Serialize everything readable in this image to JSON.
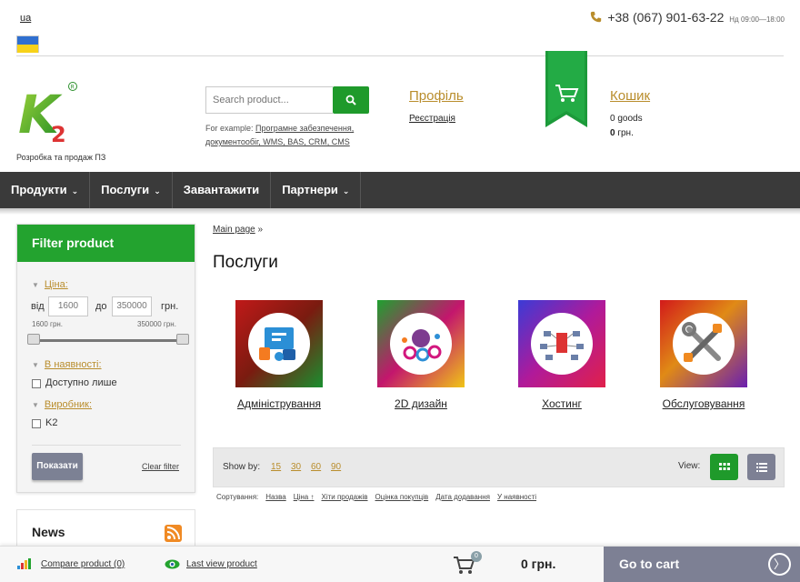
{
  "header": {
    "lang": "ua",
    "phone": "+38 (067) 901-63-22",
    "hours": "Нд 09:00—18:00",
    "logo_letter": "K",
    "logo_sup": "2",
    "logo_tagline": "Розробка та продаж ПЗ",
    "search_placeholder": "Search product...",
    "example_prefix": "For example:",
    "example_links": "Програмне забезпечення, документообіг, WMS, BAS, CRM, CMS",
    "profile_label": "Профіль",
    "register_label": "Реєстрація",
    "cart_label": "Кошик",
    "cart_goods": "0 goods",
    "cart_price_num": "0",
    "cart_price_cur": "грн."
  },
  "nav": {
    "items": [
      {
        "label": "Продукти"
      },
      {
        "label": "Послуги"
      },
      {
        "label": "Завантажити"
      },
      {
        "label": "Партнери"
      }
    ]
  },
  "filter": {
    "title": "Filter product",
    "price_section": "Ціна:",
    "from_label": "від",
    "from_value": "1600",
    "to_label": "до",
    "to_value": "350000",
    "currency": "грн.",
    "min_label": "1600 грн.",
    "max_label": "350000 грн.",
    "stock_section": "В наявності:",
    "stock_option": "Доступно лише",
    "maker_section": "Виробник:",
    "maker_option": "K2",
    "show_button": "Показати",
    "clear_link": "Clear filter"
  },
  "news": {
    "title": "News"
  },
  "main": {
    "breadcrumb_link": "Main page",
    "breadcrumb_sep": "»",
    "title": "Послуги",
    "categories": [
      {
        "label": "Адміністрування"
      },
      {
        "label": "2D дизайн"
      },
      {
        "label": "Хостинг"
      },
      {
        "label": "Обслуговування"
      }
    ],
    "show_by_label": "Show by:",
    "show_by_options": [
      "15",
      "30",
      "60",
      "90"
    ],
    "view_label": "View:",
    "sort_label": "Сортування:",
    "sort_options": [
      "Назва",
      "Ціна ↑",
      "Хіти продажів",
      "Оцінка покупців",
      "Дата додавання",
      "У наявності"
    ]
  },
  "bottom": {
    "compare": "Compare product (0)",
    "last_view": "Last view product",
    "cart_count": "0",
    "total": "0 грн.",
    "goto_cart": "Go to cart",
    "arrow": "〉"
  },
  "colors": {
    "accent_green": "#23a32f",
    "link_gold": "#b98d2c",
    "nav_dark": "#3a3a3a",
    "button_gray": "#7c8194"
  }
}
